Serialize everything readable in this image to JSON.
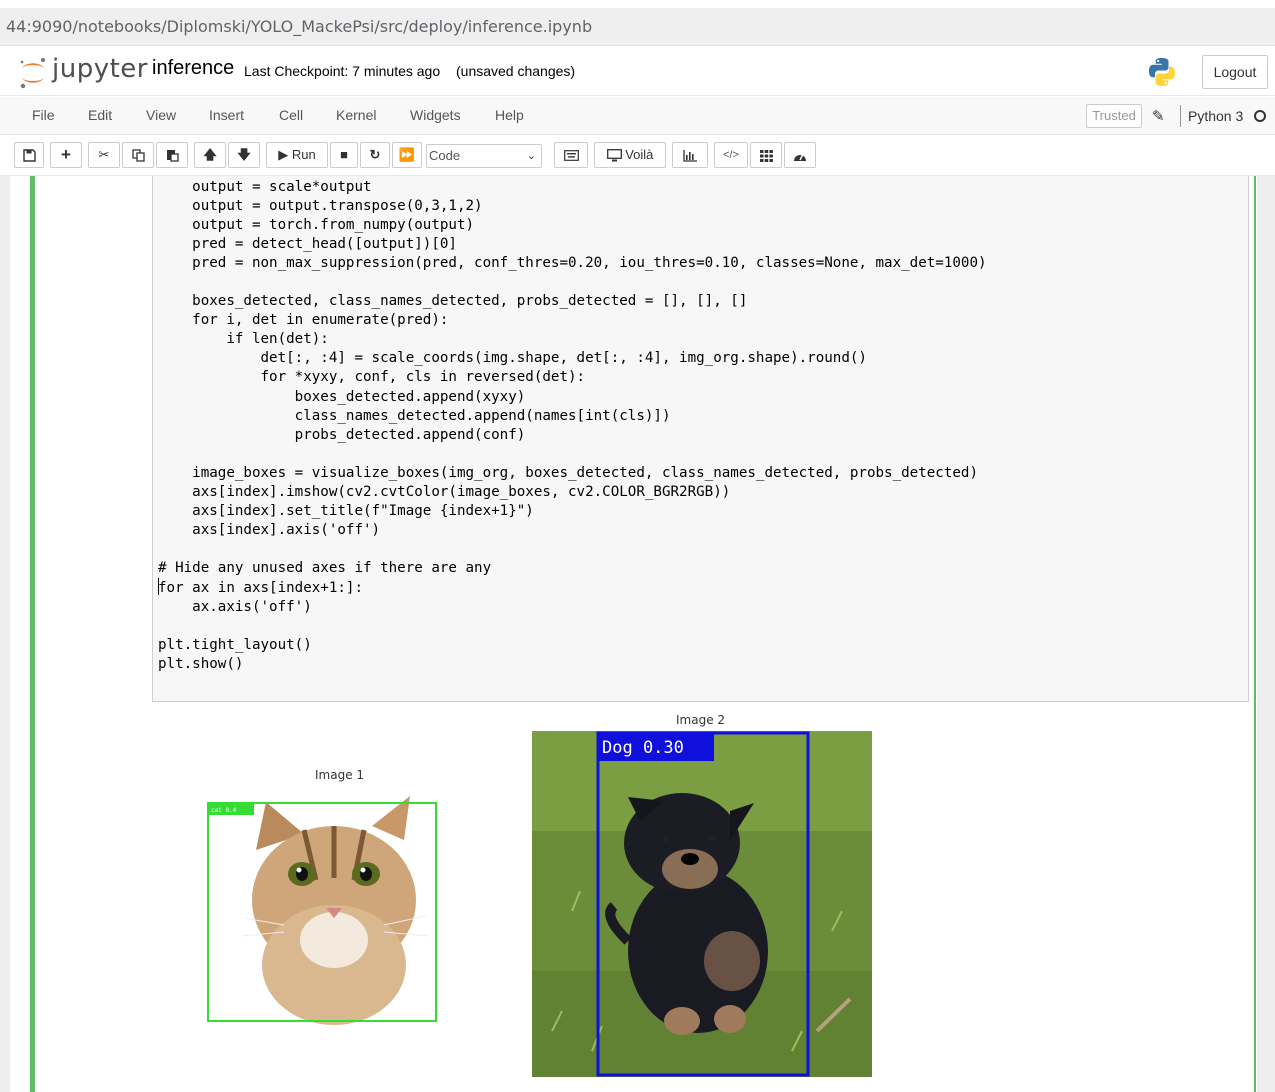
{
  "browser": {
    "url": "44:9090/notebooks/Diplomski/YOLO_MackePsi/src/deploy/inference.ipynb"
  },
  "header": {
    "logo_text": "jupyter",
    "notebook_name": "inference",
    "checkpoint": "Last Checkpoint: 7 minutes ago",
    "save_status": "(unsaved changes)",
    "logout_label": "Logout"
  },
  "menu": {
    "items": [
      "File",
      "Edit",
      "View",
      "Insert",
      "Cell",
      "Kernel",
      "Widgets",
      "Help"
    ],
    "trusted_label": "Trusted",
    "kernel_name": "Python 3"
  },
  "toolbar": {
    "run_label": "Run",
    "cell_type": "Code",
    "voila_label": "Voilà",
    "icons": [
      "save-icon",
      "plus-icon",
      "cut-icon",
      "copy-icon",
      "paste-icon",
      "arrow-up-icon",
      "arrow-down-icon",
      "play-icon",
      "stop-icon",
      "restart-icon",
      "fast-forward-icon",
      "keyboard-icon",
      "desktop-icon",
      "chart-icon",
      "code-icon",
      "grid-icon",
      "dashboard-icon"
    ]
  },
  "code_lines": [
    "    output = scale*output",
    "    output = output.transpose(0,3,1,2)",
    "    output = torch.from_numpy(output)",
    "    pred = detect_head([output])[0]",
    "    pred = non_max_suppression(pred, conf_thres=0.20, iou_thres=0.10, classes=None, max_det=1000)",
    "",
    "    boxes_detected, class_names_detected, probs_detected = [], [], []",
    "    for i, det in enumerate(pred):",
    "        if len(det):",
    "            det[:, :4] = scale_coords(img.shape, det[:, :4], img_org.shape).round()",
    "            for *xyxy, conf, cls in reversed(det):",
    "                boxes_detected.append(xyxy)",
    "                class_names_detected.append(names[int(cls)])",
    "                probs_detected.append(conf)",
    "",
    "    image_boxes = visualize_boxes(img_org, boxes_detected, class_names_detected, probs_detected)",
    "    axs[index].imshow(cv2.cvtColor(image_boxes, cv2.COLOR_BGR2RGB))",
    "    axs[index].set_title(f\"Image {index+1}\")",
    "    axs[index].axis('off')",
    "",
    "# Hide any unused axes if there are any",
    "for ax in axs[index+1:]:",
    "    ax.axis('off')",
    "",
    "plt.tight_layout()",
    "plt.show()"
  ],
  "output": {
    "image1_title": "Image 1",
    "image2_title": "Image 2",
    "image2_label": "Dog 0.30",
    "box_colors": {
      "image1": "#33dd33",
      "image2": "#1010dd"
    }
  }
}
